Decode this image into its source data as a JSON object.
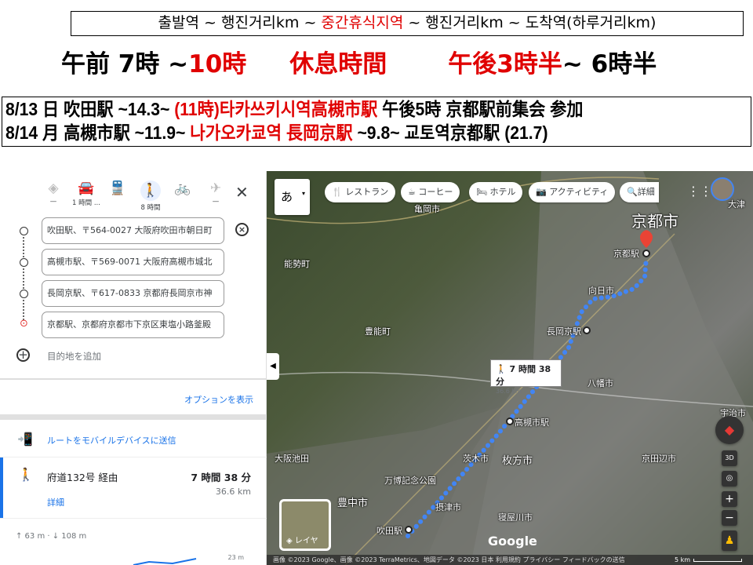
{
  "legend": {
    "p1": "출발역  ~  행진거리km ~ ",
    "p2": "중간휴식지역",
    "p3": "  ~  행진거리km ~ 도착역(하루거리km)"
  },
  "times": {
    "t1": "午前 7時 ~ ",
    "t2": "10時",
    "t3": "休息時間",
    "t4": "午後3時半",
    "t5": " ~ 6時半"
  },
  "schedule": [
    {
      "a": "8/13 日 吹田駅 ~14.3~ ",
      "b": "(11時)타카쓰키시역高槻市駅",
      "c": "     午後5時 京都駅前集会 参加"
    },
    {
      "a": "8/14 月 高槻市駅 ~11.9~ ",
      "b": "나가오카쿄역 長岡京駅",
      "c": " ~9.8~ 교토역京都駅 (21.7)"
    }
  ],
  "panel": {
    "modes": [
      {
        "icon": "directions-icon",
        "label": "—"
      },
      {
        "icon": "car-icon",
        "label": "1 時間 ..."
      },
      {
        "icon": "transit-icon",
        "label": ""
      },
      {
        "icon": "walk-icon",
        "label": "8 時間"
      },
      {
        "icon": "bicycle-icon",
        "label": ""
      },
      {
        "icon": "flight-icon",
        "label": "—"
      }
    ],
    "stops": [
      "吹田駅、〒564-0027 大阪府吹田市朝日町",
      "高槻市駅、〒569-0071 大阪府高槻市城北",
      "長岡京駅、〒617-0833 京都府長岡京市神",
      "京都駅、京都府京都市下京区東塩小路釜殿"
    ],
    "add_destination": "目的地を追加",
    "show_options": "オプションを表示",
    "send_mobile": "ルートをモバイルデバイスに送信",
    "route": {
      "via": "府道132号 経由",
      "time": "7 時間 38 分",
      "distance": "36.6 km",
      "details": "詳細"
    },
    "elevation": "↑ 63 m · ↓ 108 m",
    "elev_tick": "23 m"
  },
  "map": {
    "input_mode": "あ",
    "chips": [
      "レストラン",
      "コーヒー",
      "ホテル",
      "アクティビティ",
      "詳細"
    ],
    "chip_icons": [
      "restaurant-icon",
      "coffee-icon",
      "hotel-icon",
      "activity-icon",
      "search-icon"
    ],
    "labels": {
      "kyoto_city": "京都市",
      "kyoto_sta": "京都駅",
      "nagaokakyo": "長岡京駅",
      "takatsuki": "高槻市駅",
      "suita": "吹田駅",
      "hirakata": "枚方市",
      "toyonaka": "豊中市",
      "uji": "宇治市",
      "kameoka": "亀岡市",
      "nose": "能勢町",
      "toyono": "豊能町",
      "ikeda": "大阪池田",
      "otsu": "大津",
      "muko": "向日市",
      "yawata": "八幡市",
      "kyotanabe": "京田辺市",
      "ibaraki": "茨木市",
      "settsu": "摂津市",
      "neyagawa": "寝屋川市",
      "banpaku": "万博記念公園"
    },
    "tooltip": {
      "time": "7 時間 38 分",
      "distance": "36.6 km"
    },
    "layers": "レイヤ",
    "btn_3d": "3D",
    "attribution": "画像 ©2023 Google、画像 ©2023 TerraMetrics、地図データ ©2023   日本   利用規約   プライバシー   フィードバックの送信",
    "scale": "5 km",
    "route_color": "#4285f4",
    "pin_color": "#ea4335"
  }
}
